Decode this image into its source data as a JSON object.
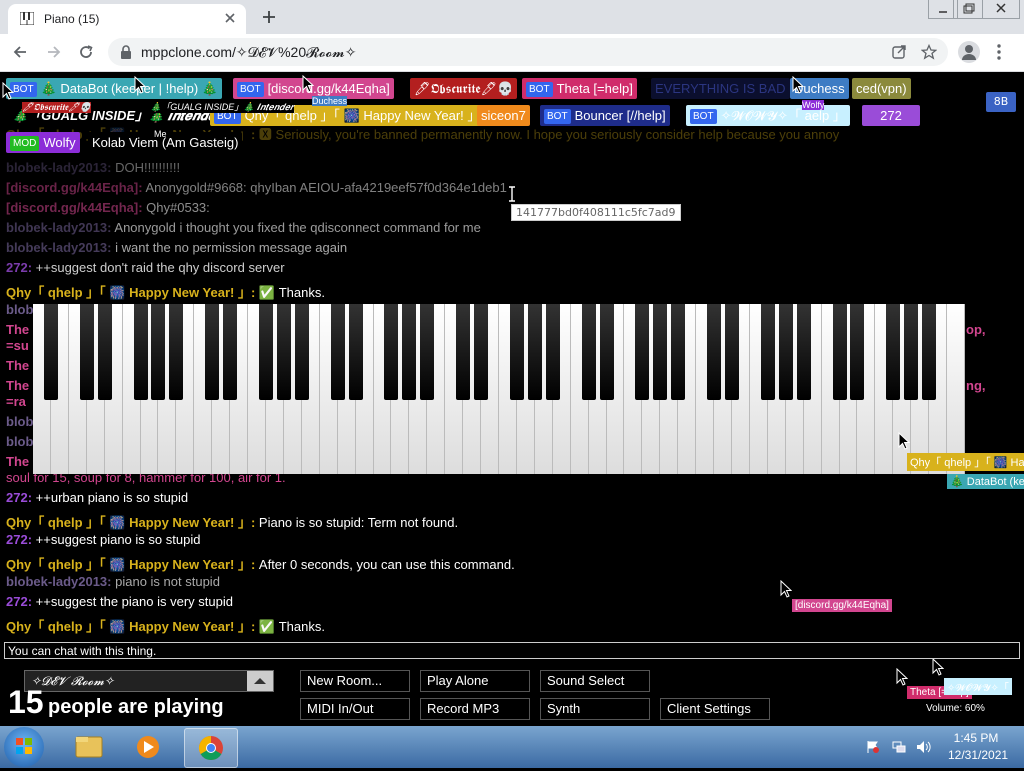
{
  "browser": {
    "tab_title": "Piano (15)",
    "url": "mppclone.com/✧𝓓𝓔𝓥%20𝓡𝓸𝓸𝓶✧"
  },
  "users": [
    {
      "tag": "BOT",
      "name": "🎄 DataBot (keeper | !help) 🎄",
      "color": "#3aa7b3"
    },
    {
      "tag": "BOT",
      "name": "[discord.gg/k44Eqha]",
      "color": "#d2468f"
    },
    {
      "tag": "",
      "name": "🖊𝕺𝖇𝖘𝖈𝖚𝖗𝖎𝖙𝖊🖊💀",
      "color": "#b31f1f"
    },
    {
      "tag": "BOT",
      "name": "Theta [=help]",
      "color": "#d02c6b"
    },
    {
      "tag": "",
      "name": "EVERYTHING IS BAD",
      "color": "#0b0f2e"
    },
    {
      "tag": "",
      "name": "Duchess",
      "color": "#3e7cc4"
    },
    {
      "tag": "",
      "name": "ced(vpn)",
      "color": "#8b8a3c"
    },
    {
      "tag": "",
      "name": "🎄「GUALG INSIDE」🎄 𝑰𝒏𝒕𝒆𝒏𝒅𝒆𝒓",
      "color": "#000000"
    },
    {
      "tag": "BOT",
      "name": "Qhy「 qhelp 」「 🎆 Happy New Year! 」",
      "color": "#d8b21c"
    },
    {
      "tag": "",
      "name": "siceon7",
      "color": "#f08a1c"
    },
    {
      "tag": "BOT",
      "name": "Bouncer [//help]",
      "color": "#1e2c8a"
    },
    {
      "tag": "BOT",
      "name": "✧𝓦𝓞𝓦𝓨✧「 aelp 」",
      "color": "#c8f0ff"
    },
    {
      "tag": "",
      "name": "272",
      "color": "#9a4cd8"
    },
    {
      "tag": "MOD",
      "name": "Wolfy",
      "color": "#8c2dd8"
    },
    {
      "tag": "",
      "name": "Kolab Viem (Am Gasteig)",
      "color": "#000000"
    }
  ],
  "mini_labels": [
    "🖊𝕺𝖇𝖘𝖈𝖚𝖗𝖎𝖙𝖊🖊💀",
    "🎄「GUALG INSIDE」🎄 𝑰𝒏𝒕𝒆𝒏𝒅𝒆𝒓",
    "Duchess",
    "Wolfy",
    "Me"
  ],
  "button_8b": "8B",
  "tooltip": "141777bd0f408111c5fc7ad9",
  "chat": [
    {
      "name": "Qhy「 qhelp 」「 🎆 Happy New Year! 」:",
      "text": "🆇 Seriously, you're banned permanently now. I hope you seriously consider help because you annoy",
      "color": "#d8b21c",
      "dim": true
    },
    {
      "name": "blobek-lady2013:",
      "text": "DOH!!!!!!!!!!",
      "color": "#6b5b8a",
      "dim": true
    },
    {
      "name": "[discord.gg/k44Eqha]:",
      "text": "Anonygold#9668: qhyIban AEIOU-afa4219eef57f0d364e1deb1",
      "color": "#d2468f",
      "dim": true
    },
    {
      "name": "[discord.gg/k44Eqha]:",
      "text": "Qhy#0533:",
      "color": "#d2468f",
      "dim": true
    },
    {
      "name": "blobek-lady2013:",
      "text": "Anonygold i thought you fixed the qdisconnect command for me",
      "color": "#6b5b8a",
      "dim": true
    },
    {
      "name": "blobek-lady2013:",
      "text": "i want the no permission message again",
      "color": "#6b5b8a",
      "dim": true
    },
    {
      "name": "272:",
      "text": "++suggest don't raid the qhy discord server",
      "color": "#9a4cd8",
      "dim": true
    },
    {
      "name": "Qhy「 qhelp 」「 🎆 Happy New Year! 」:",
      "text": "✅ Thanks.",
      "color": "#d8b21c",
      "dim": false
    },
    {
      "name": "272:",
      "text": "++urban piano is so stupid",
      "color": "#9a4cd8",
      "dim": false
    },
    {
      "name": "Qhy「 qhelp 」「 🎆 Happy New Year! 」:",
      "text": "Piano is so stupid: Term not found.",
      "color": "#d8b21c",
      "dim": false
    },
    {
      "name": "272:",
      "text": "++suggest piano is so stupid",
      "color": "#9a4cd8",
      "dim": false
    },
    {
      "name": "Qhy「 qhelp 」「 🎆 Happy New Year! 」:",
      "text": "After 0 seconds, you can use this command.",
      "color": "#d8b21c",
      "dim": false
    },
    {
      "name": "blobek-lady2013:",
      "text": "piano is not stupid",
      "color": "#6b5b8a",
      "dim": false
    },
    {
      "name": "272:",
      "text": "++suggest the piano is very stupid",
      "color": "#9a4cd8",
      "dim": false
    },
    {
      "name": "Qhy「 qhelp 」「 🎆 Happy New Year! 」:",
      "text": "✅ Thanks.",
      "color": "#d8b21c",
      "dim": false
    }
  ],
  "hidden_line_fragments": [
    "blob",
    "The",
    "=su",
    "The",
    "The",
    "=ra",
    "blob",
    "blob",
    "The",
    "op,",
    "ng,",
    "soul for 15, soup for 8, hammer for 100, air for 1."
  ],
  "cursor_labels": [
    {
      "text": "Qhy「 qhelp 」「 🎆 Happ",
      "bg": "#d8b21c",
      "fg": "#fff"
    },
    {
      "text": "🎄 DataBot (kee",
      "bg": "#3aa7b3",
      "fg": "#fff"
    },
    {
      "text": "[discord.gg/k44Eqha]",
      "bg": "#d2468f",
      "fg": "#fff"
    },
    {
      "text": "Theta [=help]",
      "bg": "#d02c6b",
      "fg": "#fff"
    },
    {
      "text": "✧𝓦𝓞𝓦𝓨✧「",
      "bg": "#c8f0ff",
      "fg": "#fff"
    }
  ],
  "chat_input": {
    "placeholder": "You can chat with this thing."
  },
  "room": {
    "name": "✧𝓓𝓔𝓥 𝓡𝓸𝓸𝓶✧"
  },
  "player_count": {
    "number": "15",
    "text": "people are playing"
  },
  "controls": {
    "new_room": "New Room...",
    "play_alone": "Play Alone",
    "sound_select": "Sound Select",
    "midi": "MIDI In/Out",
    "record": "Record MP3",
    "synth": "Synth",
    "client_settings": "Client Settings"
  },
  "volume": "Volume: 60%",
  "clock": {
    "time": "1:45 PM",
    "date": "12/31/2021"
  },
  "colors": {
    "page_bg": "#000000",
    "taskbar": "#3b6aa3"
  },
  "icons": [
    "piano-favicon-icon",
    "close-icon",
    "plus-icon",
    "back-icon",
    "forward-icon",
    "reload-icon",
    "lock-icon",
    "share-icon",
    "star-icon",
    "profile-icon",
    "menu-icon",
    "windows-start-icon",
    "explorer-icon",
    "media-player-icon",
    "chrome-icon"
  ]
}
